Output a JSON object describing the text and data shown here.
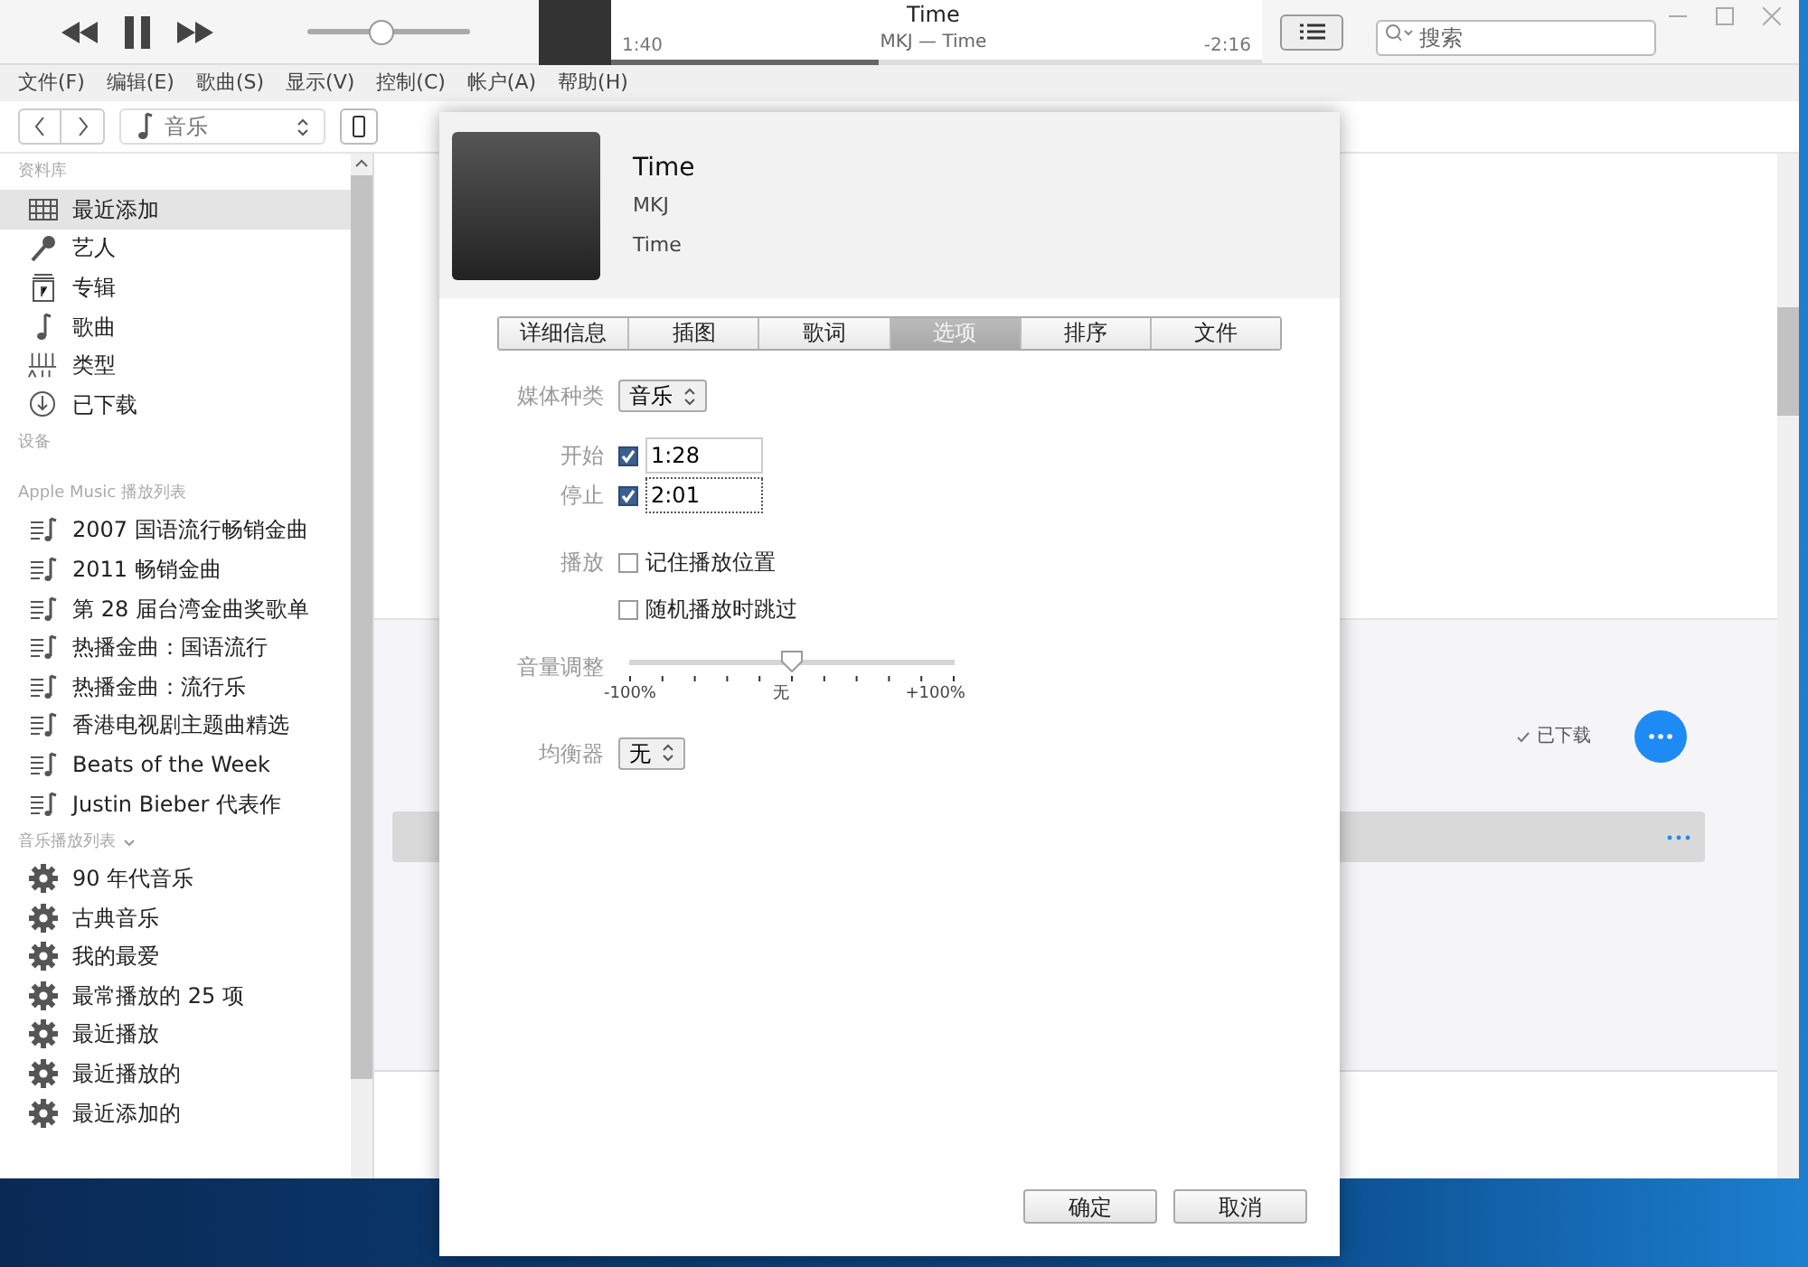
{
  "player": {
    "volume": {
      "level": 0.45
    },
    "now_playing": {
      "title": "Time",
      "subtitle": "MKJ — Time",
      "elapsed": "1:40",
      "remaining": "-2:16",
      "level": 0.41
    },
    "search": {
      "placeholder": "搜索"
    }
  },
  "menu_bar": [
    "文件(F)",
    "编辑(E)",
    "歌曲(S)",
    "显示(V)",
    "控制(C)",
    "帐户(A)",
    "帮助(H)"
  ],
  "nav": {
    "media_picker": "音乐"
  },
  "sidebar": {
    "sections": [
      {
        "title": "资料库",
        "collapsible": false,
        "items": [
          {
            "label": "最近添加",
            "kind": "grid",
            "selected": true
          },
          {
            "label": "艺人",
            "kind": "mic",
            "selected": false
          },
          {
            "label": "专辑",
            "kind": "album",
            "selected": false
          },
          {
            "label": "歌曲",
            "kind": "note",
            "selected": false
          },
          {
            "label": "类型",
            "kind": "genre",
            "selected": false
          },
          {
            "label": "已下载",
            "kind": "download",
            "selected": false
          }
        ]
      },
      {
        "title": "设备",
        "collapsible": false
      },
      {
        "title": "Apple Music 播放列表",
        "collapsible": false,
        "items": [
          {
            "label": "2007 国语流行畅销金曲",
            "kind": "playlist",
            "selected": false
          },
          {
            "label": "2011 畅销金曲",
            "kind": "playlist",
            "selected": false
          },
          {
            "label": "第 28 届台湾金曲奖歌单",
            "kind": "playlist",
            "selected": false
          },
          {
            "label": "热播金曲：国语流行",
            "kind": "playlist",
            "selected": false
          },
          {
            "label": "热播金曲：流行乐",
            "kind": "playlist",
            "selected": false
          },
          {
            "label": "香港电视剧主题曲精选",
            "kind": "playlist",
            "selected": false
          },
          {
            "label": "Beats of the Week",
            "kind": "playlist",
            "selected": false
          },
          {
            "label": "Justin Bieber 代表作",
            "kind": "playlist",
            "selected": false
          }
        ]
      },
      {
        "title": "音乐播放列表",
        "collapsible": true,
        "items": [
          {
            "label": "90 年代音乐",
            "kind": "smart",
            "selected": false
          },
          {
            "label": "古典音乐",
            "kind": "smart",
            "selected": false
          },
          {
            "label": "我的最爱",
            "kind": "smart",
            "selected": false
          },
          {
            "label": "最常播放的 25 项",
            "kind": "smart",
            "selected": false
          },
          {
            "label": "最近播放",
            "kind": "smart",
            "selected": false
          },
          {
            "label": "最近播放的",
            "kind": "smart",
            "selected": false
          },
          {
            "label": "最近添加的",
            "kind": "smart",
            "selected": false
          }
        ]
      }
    ]
  },
  "content": {
    "downloaded_label": "已下载"
  },
  "dialog": {
    "title": "Time",
    "artist": "MKJ",
    "album": "Time",
    "tabs": [
      {
        "label": "详细信息",
        "selected": false
      },
      {
        "label": "插图",
        "selected": false
      },
      {
        "label": "歌词",
        "selected": false
      },
      {
        "label": "选项",
        "selected": true
      },
      {
        "label": "排序",
        "selected": false
      },
      {
        "label": "文件",
        "selected": false
      }
    ],
    "media_kind": {
      "label": "媒体种类",
      "value": "音乐"
    },
    "start": {
      "label": "开始",
      "checked": true,
      "value": "1:28"
    },
    "stop": {
      "label": "停止",
      "checked": true,
      "value": "2:01"
    },
    "playback": {
      "label": "播放",
      "options": [
        {
          "label": "记住播放位置",
          "checked": false
        },
        {
          "label": "随机播放时跳过",
          "checked": false
        }
      ]
    },
    "volume_adjust": {
      "label": "音量调整",
      "level": 0.5,
      "min_label": "-100%",
      "mid_label": "无",
      "max_label": "+100%"
    },
    "equalizer": {
      "label": "均衡器",
      "value": "无"
    },
    "buttons": [
      "确定",
      "取消"
    ]
  }
}
